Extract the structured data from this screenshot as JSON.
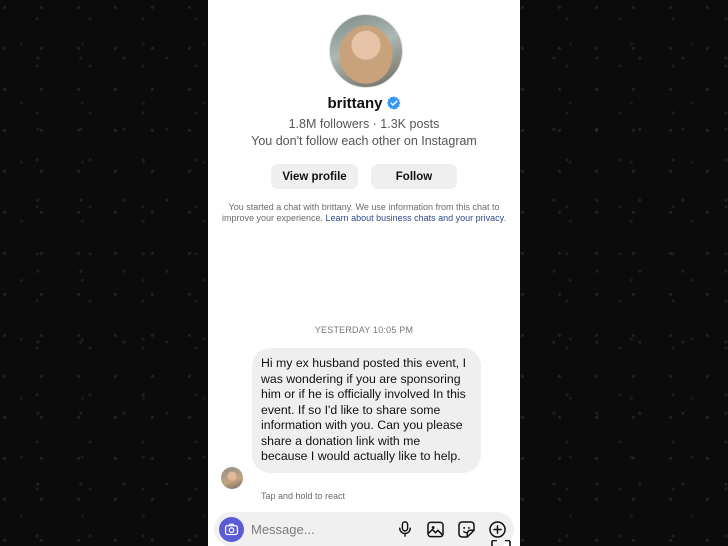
{
  "profile": {
    "username": "brittany",
    "stats": "1.8M followers · 1.3K posts",
    "follow_note": "You don't follow each other on Instagram",
    "view_profile_label": "View profile",
    "follow_label": "Follow"
  },
  "disclaimer": {
    "text": "You started a chat with brittany. We use information from this chat to improve your experience. ",
    "link": "Learn about business chats and your privacy",
    "end": "."
  },
  "conversation": {
    "timestamp": "YESTERDAY 10:05 PM",
    "message": "Hi my ex husband posted this event, I was wondering if you are sponsoring him or if he is officially involved In this event. If so I'd like to share some information with you. Can you please share a donation link with me because I would actually like to help.",
    "hint": "Tap and hold to react"
  },
  "composer": {
    "placeholder": "Message..."
  },
  "icons": {
    "verified": "verified-badge-icon",
    "camera": "camera-icon",
    "mic": "microphone-icon",
    "gallery": "gallery-icon",
    "sticker": "sticker-icon",
    "add": "plus-circle-icon",
    "scan": "scan-corner-icon"
  },
  "colors": {
    "verified": "#3797f0",
    "camera_bg": "#5b5bd6",
    "link": "#2e4a8c",
    "bubble": "#efefef"
  }
}
